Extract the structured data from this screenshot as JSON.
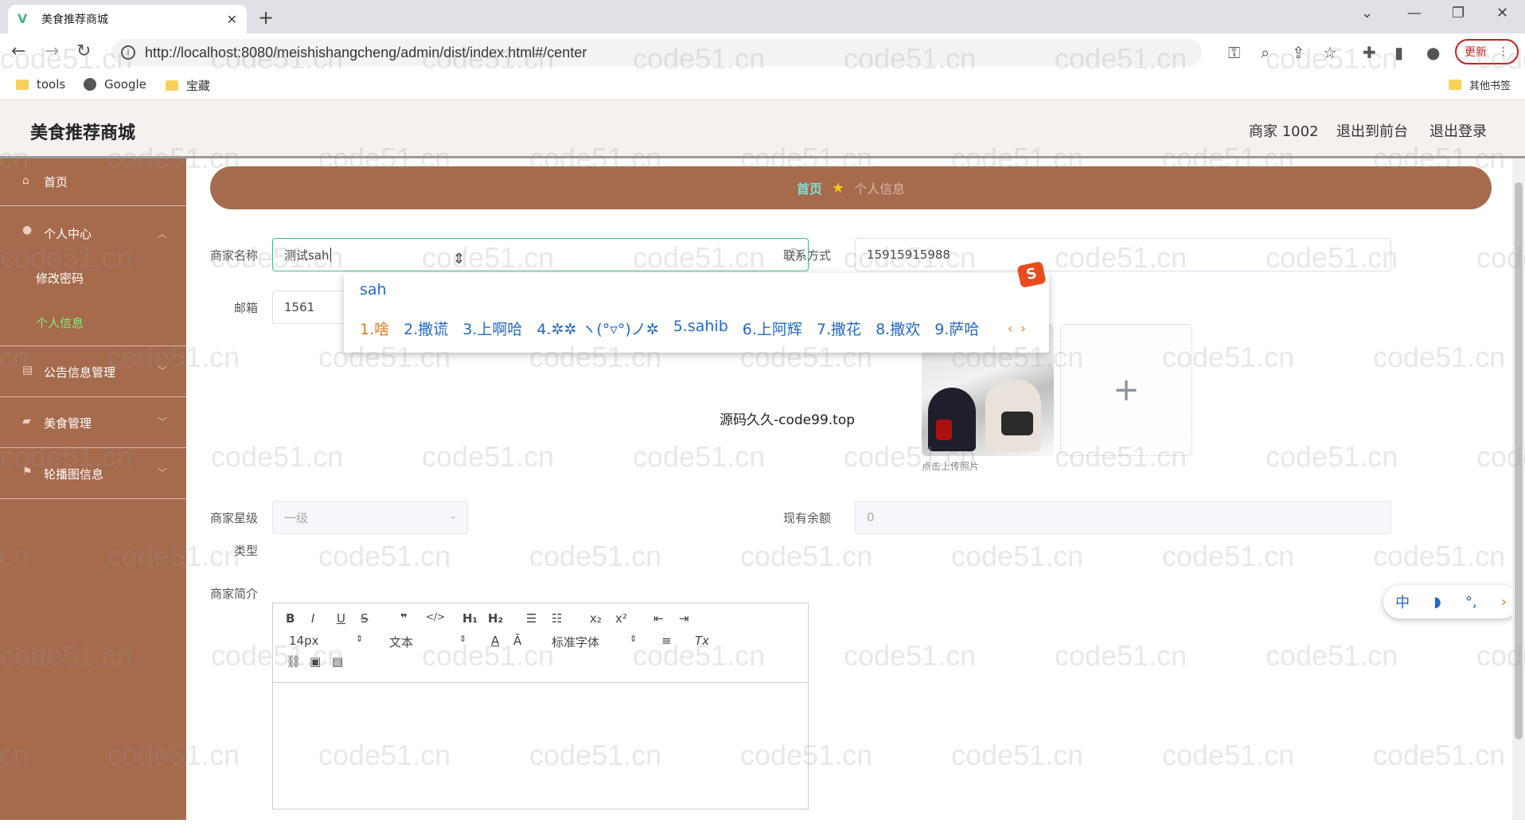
{
  "browser": {
    "tab_title": "美食推荐商城",
    "url": "http://localhost:8080/meishishangcheng/admin/dist/index.html#/center",
    "update_label": "更新",
    "bookmarks": [
      "tools",
      "Google",
      "宝藏"
    ],
    "other_bookmarks": "其他书签"
  },
  "header": {
    "title": "美食推荐商城",
    "user": "商家 1002",
    "to_front": "退出到前台",
    "logout": "退出登录"
  },
  "sidebar": {
    "home": "首页",
    "personal_center": "个人中心",
    "change_password": "修改密码",
    "personal_info": "个人信息",
    "notice_mgmt": "公告信息管理",
    "food_mgmt": "美食管理",
    "carousel_info": "轮播图信息"
  },
  "breadcrumb": {
    "home": "首页",
    "current": "个人信息"
  },
  "form": {
    "merchant_name_label": "商家名称",
    "merchant_name_value": "测试sah",
    "contact_label": "联系方式",
    "contact_value": "15915915988",
    "email_label": "邮箱",
    "email_value": "1561",
    "upload_tip": "点击上传照片",
    "level_label": "商家星级",
    "level_value": "一级",
    "balance_label": "现有余额",
    "balance_value": "0",
    "type_label": "类型",
    "intro_label": "商家简介"
  },
  "editor": {
    "font_size": "14px",
    "paragraph": "文本",
    "font_family": "标准字体"
  },
  "ime": {
    "composition": "sah",
    "candidates": [
      "1.啥",
      "2.撒谎",
      "3.上啊哈",
      "4.✲✲ ヽ(°▿°)ノ✲",
      "5.sahib",
      "6.上阿辉",
      "7.撒花",
      "8.撒欢",
      "9.萨哈"
    ],
    "float_chars": [
      "中",
      "◗",
      "°,",
      "›"
    ]
  },
  "overlay_text": "源码久久-code99.top",
  "watermark": "code51.cn"
}
